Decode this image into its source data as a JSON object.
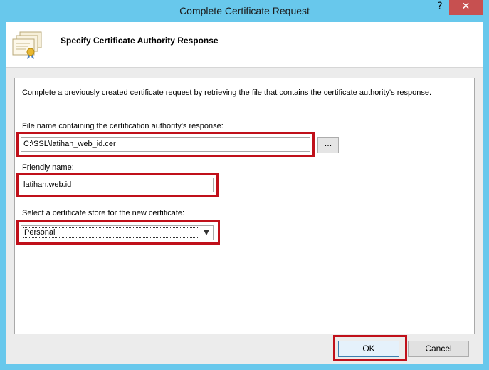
{
  "window": {
    "title": "Complete Certificate Request",
    "help_label": "?",
    "close_label": "✕"
  },
  "header": {
    "title": "Specify Certificate Authority Response",
    "icon": "certificate-icon"
  },
  "content": {
    "description": "Complete a previously created certificate request by retrieving the file that contains the certificate authority's response.",
    "file": {
      "label": "File name containing the certification authority's response:",
      "value": "C:\\SSL\\latihan_web_id.cer",
      "browse_label": "..."
    },
    "friendly": {
      "label": "Friendly name:",
      "value": "latihan.web.id"
    },
    "store": {
      "label": "Select a certificate store for the new certificate:",
      "selected": "Personal"
    }
  },
  "buttons": {
    "ok": "OK",
    "cancel": "Cancel"
  },
  "colors": {
    "titlebar": "#68c8ec",
    "highlight": "#c0101a",
    "close": "#c75050"
  }
}
